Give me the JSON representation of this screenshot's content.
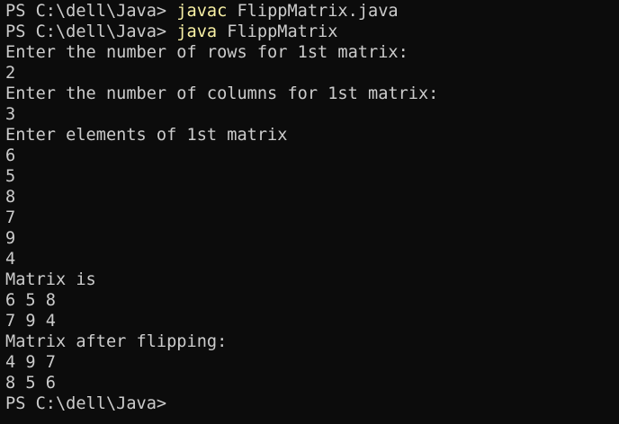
{
  "terminal": {
    "prompt": "PS C:\\dell\\Java> ",
    "commands": [
      {
        "keyword": "javac",
        "args": " FlippMatrix.java"
      },
      {
        "keyword": "java",
        "args": " FlippMatrix"
      }
    ],
    "output": [
      "Enter the number of rows for 1st matrix:",
      "2",
      "Enter the number of columns for 1st matrix:",
      "3",
      "Enter elements of 1st matrix",
      "6",
      "5",
      "8",
      "7",
      "9",
      "4",
      "Matrix is",
      "6 5 8",
      "7 9 4",
      "Matrix after flipping:",
      "4 9 7",
      "8 5 6"
    ],
    "final_prompt": "PS C:\\dell\\Java>",
    "colors": {
      "background": "#0c0c0c",
      "text": "#cccccc",
      "command": "#f9f1a5"
    }
  }
}
